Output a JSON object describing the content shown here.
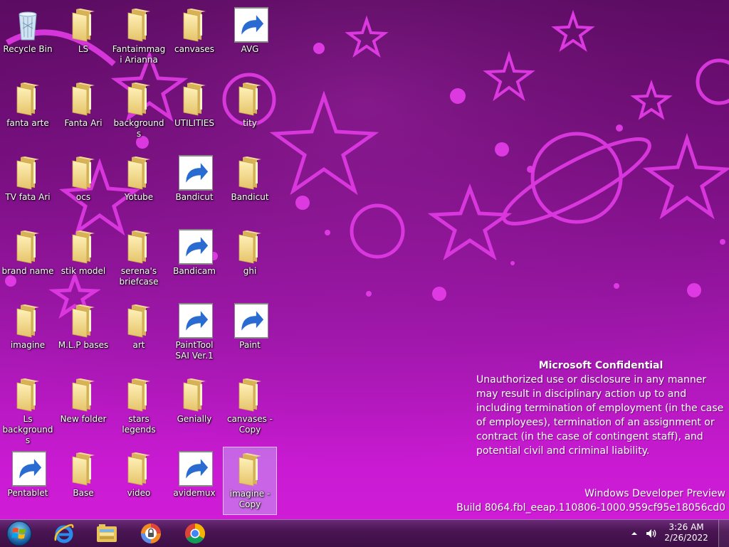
{
  "desktop": {
    "icons": [
      {
        "label": "Recycle Bin",
        "type": "recycle-bin",
        "col": 0,
        "row": 0
      },
      {
        "label": "LS",
        "type": "folder",
        "col": 1,
        "row": 0
      },
      {
        "label": "Fantaimmagi Arianna",
        "type": "folder",
        "col": 2,
        "row": 0
      },
      {
        "label": "canvases",
        "type": "folder",
        "col": 3,
        "row": 0
      },
      {
        "label": "AVG",
        "type": "avg",
        "col": 4,
        "row": 0,
        "shortcut": true
      },
      {
        "label": "fanta arte",
        "type": "folder",
        "col": 0,
        "row": 1
      },
      {
        "label": "Fanta Ari",
        "type": "folder",
        "col": 1,
        "row": 1
      },
      {
        "label": "backgrounds",
        "type": "folder",
        "col": 2,
        "row": 1
      },
      {
        "label": "UTILITIES",
        "type": "folder",
        "col": 3,
        "row": 1
      },
      {
        "label": "tity",
        "type": "folder",
        "col": 4,
        "row": 1
      },
      {
        "label": "TV  fata Ari",
        "type": "folder",
        "col": 0,
        "row": 2
      },
      {
        "label": "ocs",
        "type": "folder",
        "col": 1,
        "row": 2
      },
      {
        "label": "Yotube",
        "type": "folder",
        "col": 2,
        "row": 2
      },
      {
        "label": "Bandicut",
        "type": "bandicut",
        "col": 3,
        "row": 2,
        "shortcut": true
      },
      {
        "label": "Bandicut",
        "type": "folder",
        "col": 4,
        "row": 2
      },
      {
        "label": "brand name",
        "type": "folder",
        "col": 0,
        "row": 3
      },
      {
        "label": "stik  model",
        "type": "folder",
        "col": 1,
        "row": 3
      },
      {
        "label": "serena's briefcase",
        "type": "folder",
        "col": 2,
        "row": 3
      },
      {
        "label": "Bandicam",
        "type": "bandicam",
        "col": 3,
        "row": 3,
        "shortcut": true
      },
      {
        "label": "ghi",
        "type": "folder",
        "col": 4,
        "row": 3
      },
      {
        "label": "imagine",
        "type": "folder",
        "col": 0,
        "row": 4
      },
      {
        "label": "M.L.P bases",
        "type": "folder",
        "col": 1,
        "row": 4
      },
      {
        "label": "art",
        "type": "folder",
        "col": 2,
        "row": 4
      },
      {
        "label": "PaintTool SAI Ver.1",
        "type": "sai",
        "col": 3,
        "row": 4,
        "shortcut": true
      },
      {
        "label": "Paint",
        "type": "paint",
        "col": 4,
        "row": 4,
        "shortcut": true
      },
      {
        "label": "Ls backgrounds",
        "type": "folder",
        "col": 0,
        "row": 5
      },
      {
        "label": "New folder",
        "type": "folder",
        "col": 1,
        "row": 5
      },
      {
        "label": "stars legends",
        "type": "folder",
        "col": 2,
        "row": 5
      },
      {
        "label": "Genially",
        "type": "folder",
        "col": 3,
        "row": 5
      },
      {
        "label": "canvases - Copy",
        "type": "folder",
        "col": 4,
        "row": 5
      },
      {
        "label": "Pentablet",
        "type": "pentablet",
        "col": 0,
        "row": 6,
        "shortcut": true
      },
      {
        "label": "Base",
        "type": "folder",
        "col": 1,
        "row": 6
      },
      {
        "label": "video",
        "type": "folder",
        "col": 2,
        "row": 6
      },
      {
        "label": "avidemux",
        "type": "avidemux",
        "col": 3,
        "row": 6,
        "shortcut": true
      },
      {
        "label": "imagine - Copy",
        "type": "folder",
        "col": 4,
        "row": 6,
        "selected": true
      }
    ]
  },
  "watermark": {
    "heading": "Microsoft Confidential",
    "body": "Unauthorized use or disclosure in any manner may result in disciplinary action up to and including termination of employment (in the case of employees), termination of an assignment or contract (in the case of contingent staff), and potential civil and criminal liability.",
    "edition": "Windows Developer Preview",
    "build": "Build 8064.fbl_eeap.110806-1000.959cf95e18056cd0"
  },
  "taskbar": {
    "pinned": [
      {
        "name": "start-button",
        "icon": "windows-orb-icon"
      },
      {
        "name": "taskbar-internet-explorer",
        "icon": "internet-explorer-icon"
      },
      {
        "name": "taskbar-file-explorer",
        "icon": "folder-library-icon"
      },
      {
        "name": "taskbar-secure-browser",
        "icon": "lock-browser-icon"
      },
      {
        "name": "taskbar-chrome",
        "icon": "chrome-icon"
      }
    ],
    "clock": {
      "time": "3:26 AM",
      "date": "2/26/2022"
    },
    "colors": {
      "accent": "#b21bbd",
      "bar": "#4a1553"
    }
  }
}
